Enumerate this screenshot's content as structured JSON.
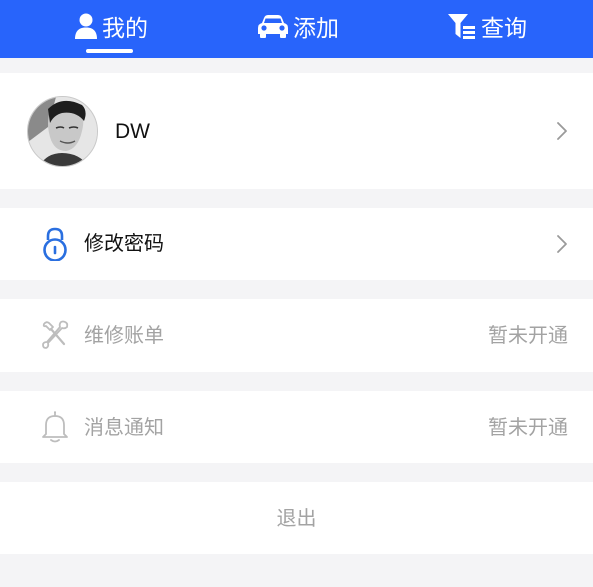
{
  "tabs": [
    {
      "label": "我的",
      "icon": "person-icon",
      "active": true
    },
    {
      "label": "添加",
      "icon": "car-icon",
      "active": false
    },
    {
      "label": "查询",
      "icon": "filter-list-icon",
      "active": false
    }
  ],
  "profile": {
    "username": "DW",
    "avatar": "user-avatar-photo"
  },
  "menu": {
    "change_password": {
      "label": "修改密码",
      "icon": "lock-icon"
    },
    "repair_bill": {
      "label": "维修账单",
      "status": "暂未开通",
      "icon": "tools-icon"
    },
    "notifications": {
      "label": "消息通知",
      "status": "暂未开通",
      "icon": "bell-icon"
    }
  },
  "logout": {
    "label": "退出"
  },
  "colors": {
    "brand": "#2864fb",
    "accent_icon": "#2a6fe0",
    "disabled_text": "#a3a3a3",
    "background": "#f4f4f6"
  }
}
